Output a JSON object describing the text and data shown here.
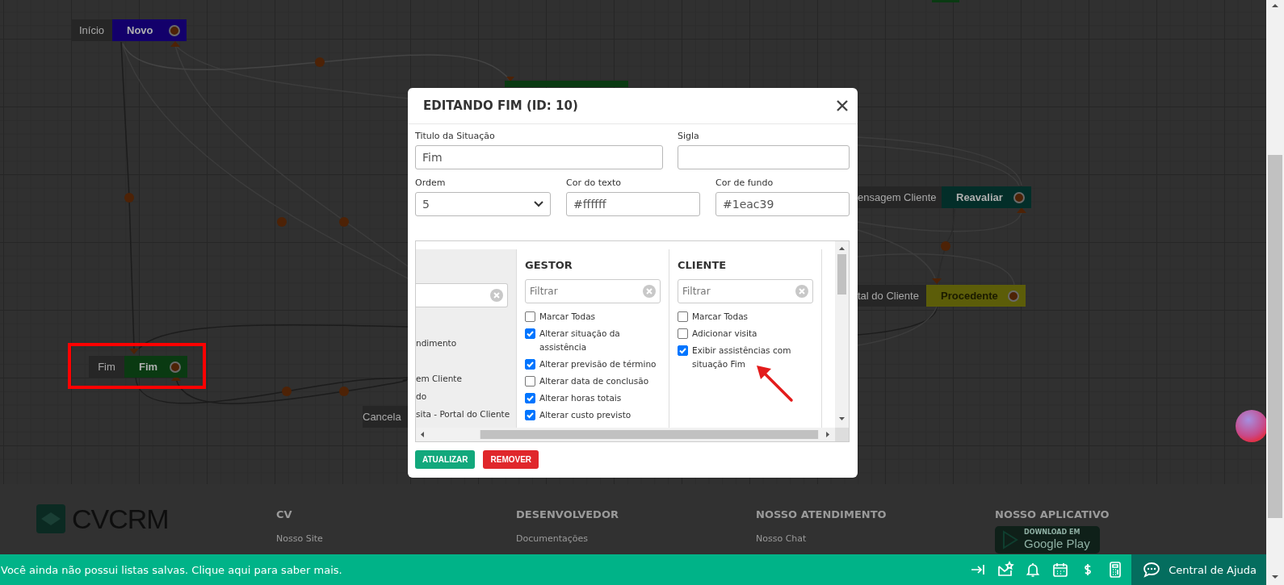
{
  "canvas": {
    "nodes": [
      {
        "label": "Início",
        "title": "Novo",
        "color": "#13006b"
      },
      {
        "label": "Fim",
        "title": "Fim",
        "color": "#0a3a12"
      },
      {
        "label": "Cancela"
      },
      {
        "label": "ensagem Cliente",
        "title": "Reavaliar",
        "color": "#032e29"
      },
      {
        "label": "tal do Cliente",
        "title": "Procedente",
        "color": "#5c5d09"
      }
    ]
  },
  "modal": {
    "title": "EDITANDO FIM (ID: 10)",
    "fields": [
      {
        "label": "Titulo da Situação",
        "value": "Fim",
        "kind": "text"
      },
      {
        "label": "Sigla",
        "kind": "text"
      },
      {
        "label": "Ordem",
        "value": "5",
        "kind": "select"
      },
      {
        "label": "Cor do texto",
        "value": "#ffffff",
        "kind": "text"
      },
      {
        "label": "Cor de fundo",
        "value": "#1eac39",
        "kind": "text"
      }
    ],
    "columns": [
      {
        "items": [
          {
            "text": "ndimento"
          },
          {
            "text": "em Cliente"
          },
          {
            "text": "do"
          },
          {
            "text": "sita - Portal do Cliente"
          }
        ]
      },
      {
        "heading": "GESTOR",
        "filter_placeholder": "Filtrar",
        "items": [
          {
            "text": "Marcar Todas",
            "checked": false
          },
          {
            "text": "Alterar situação da assistência",
            "checked": true
          },
          {
            "text": "Alterar previsão de término",
            "checked": true
          },
          {
            "text": "Alterar data de conclusão",
            "checked": false
          },
          {
            "text": "Alterar horas totais",
            "checked": true
          },
          {
            "text": "Alterar custo previsto",
            "checked": true
          }
        ]
      },
      {
        "heading": "CLIENTE",
        "filter_placeholder": "Filtrar",
        "items": [
          {
            "text": "Marcar Todas",
            "checked": false
          },
          {
            "text": "Adicionar visita",
            "checked": false
          },
          {
            "text": "Exibir assistências com situação Fim",
            "checked": true
          }
        ]
      }
    ],
    "buttons": [
      {
        "label": "ATUALIZAR",
        "kind": "primary"
      },
      {
        "label": "REMOVER",
        "kind": "danger"
      }
    ]
  },
  "footer": {
    "brand": "**CV**CRM",
    "columns": [
      {
        "heading": "CV",
        "links": [
          "Nosso Site"
        ]
      },
      {
        "heading": "DESENVOLVEDOR",
        "links": [
          "Documentações"
        ]
      },
      {
        "heading": "NOSSO ATENDIMENTO",
        "links": [
          "Nosso Chat"
        ]
      },
      {
        "heading": "NOSSO APLICATIVO",
        "badge": {
          "caption": "DOWNLOAD EM",
          "name": "Google Play"
        }
      }
    ]
  },
  "status_bar": {
    "message": "Você ainda não possui listas salvas. Clique aqui para saber mais.",
    "help": "Central de Ajuda"
  }
}
